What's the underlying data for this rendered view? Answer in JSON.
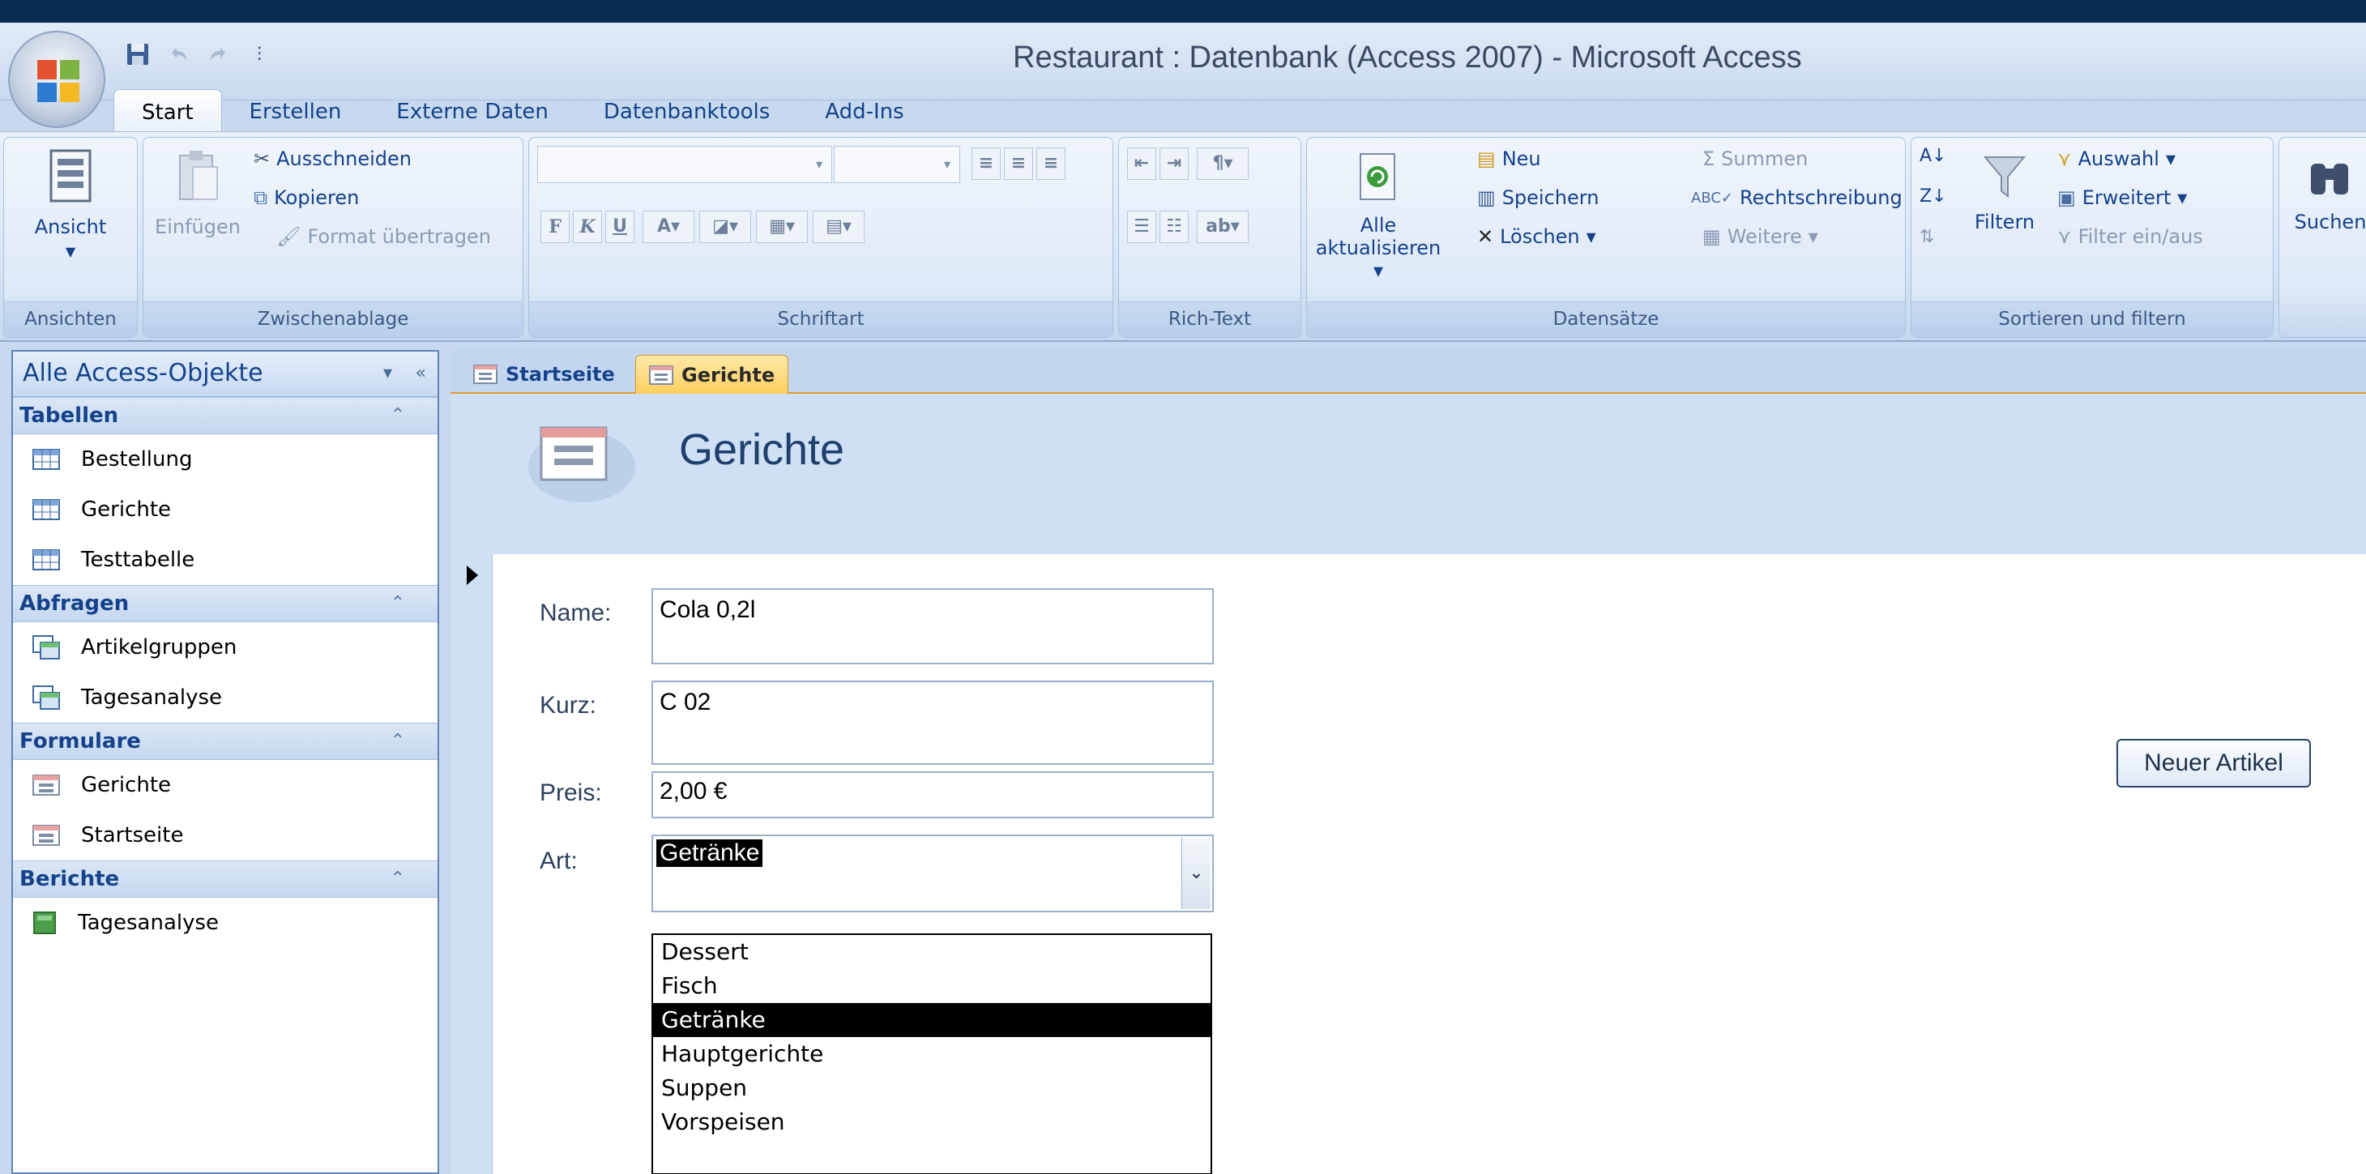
{
  "window": {
    "title": "Restaurant : Datenbank (Access 2007) - Microsoft Access"
  },
  "ribbon": {
    "tabs": [
      "Start",
      "Erstellen",
      "Externe Daten",
      "Datenbanktools",
      "Add-Ins"
    ],
    "active_tab": "Start",
    "groups": {
      "ansichten": {
        "label": "Ansichten",
        "ansicht": "Ansicht"
      },
      "zwischenablage": {
        "label": "Zwischenablage",
        "einfuegen": "Einfügen",
        "ausschneiden": "Ausschneiden",
        "kopieren": "Kopieren",
        "format": "Format übertragen"
      },
      "schriftart": {
        "label": "Schriftart"
      },
      "richtext": {
        "label": "Rich-Text"
      },
      "datensaetze": {
        "label": "Datensätze",
        "alle": "Alle",
        "aktualisieren": "aktualisieren",
        "neu": "Neu",
        "speichern": "Speichern",
        "loeschen": "Löschen",
        "summen": "Summen",
        "rechtschreibung": "Rechtschreibung",
        "weitere": "Weitere"
      },
      "sortieren": {
        "label": "Sortieren und filtern",
        "filtern": "Filtern",
        "auswahl": "Auswahl",
        "erweitert": "Erweitert",
        "filter_ein_aus": "Filter ein/aus"
      },
      "suchen": {
        "label": "Suchen"
      }
    }
  },
  "navpane": {
    "header": "Alle Access-Objekte",
    "sections": [
      {
        "title": "Tabellen",
        "items": [
          "Bestellung",
          "Gerichte",
          "Testtabelle"
        ]
      },
      {
        "title": "Abfragen",
        "items": [
          "Artikelgruppen",
          "Tagesanalyse"
        ]
      },
      {
        "title": "Formulare",
        "items": [
          "Gerichte",
          "Startseite"
        ]
      },
      {
        "title": "Berichte",
        "items": [
          "Tagesanalyse"
        ]
      }
    ]
  },
  "doc_tabs": [
    "Startseite",
    "Gerichte"
  ],
  "active_doc_tab": "Gerichte",
  "form": {
    "title": "Gerichte",
    "fields": {
      "name": {
        "label": "Name:",
        "value": "Cola 0,2l"
      },
      "kurz": {
        "label": "Kurz:",
        "value": "C 02"
      },
      "preis": {
        "label": "Preis:",
        "value": "2,00 €"
      },
      "art": {
        "label": "Art:",
        "value": "Getränke"
      }
    },
    "art_options": [
      "Dessert",
      "Fisch",
      "Getränke",
      "Hauptgerichte",
      "Suppen",
      "Vorspeisen"
    ],
    "art_selected_index": 2,
    "new_button": "Neuer Artikel"
  },
  "colors": {
    "ribbon_text": "#15428b",
    "active_tab": "#ffcf5e",
    "selection": "#000000"
  }
}
